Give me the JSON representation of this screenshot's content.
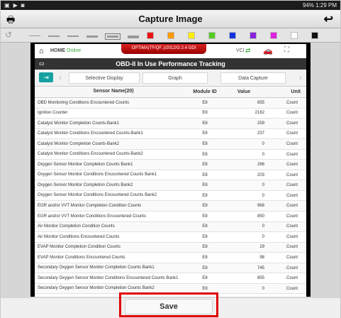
{
  "status_bar": {
    "right": "94% 1:29 PM"
  },
  "title_bar": {
    "title": "Capture Image"
  },
  "toolbar": {
    "swatches": [
      "#ee1111",
      "#ff9900",
      "#ffee00",
      "#55cc22",
      "#1133dd",
      "#8822dd",
      "#dd22dd",
      "#ffffff",
      "#111111"
    ]
  },
  "app_header": {
    "home": "HOME",
    "online": "Online",
    "vehicle": "OPTIMA(TF/QF..)/2012/G 2.4 GDI",
    "vci": "VCI"
  },
  "page_title": "OBD-II In Use Performance Tracking",
  "tabs": [
    "Selective Display",
    "Graph",
    "Data Capture"
  ],
  "table": {
    "columns": [
      "Sensor Name(20)",
      "Module ID",
      "Value",
      "Unit"
    ],
    "rows": [
      [
        "OBD Monitoring Conditions Encountered Counts",
        "E8",
        "855",
        "Count"
      ],
      [
        "Ignition Counter",
        "E8",
        "2162",
        "Count"
      ],
      [
        "Catalyst Monitor Completion Counts-Bank1",
        "E8",
        "259",
        "Count"
      ],
      [
        "Catalyst Monitor Conditions Encountered Counts-Bank1",
        "E8",
        "237",
        "Count"
      ],
      [
        "Catalyst Monitor Completion Counts-Bank2",
        "E8",
        "0",
        "Count"
      ],
      [
        "Catalyst Monitor Conditions Encountered Counts-Bank2",
        "E8",
        "0",
        "Count"
      ],
      [
        "Oxygen Sensor Monitor Completion Counts Bank1",
        "E8",
        "266",
        "Count"
      ],
      [
        "Oxygen Sensor Monitor Conditions Encountered Counts Bank1",
        "E8",
        "203",
        "Count"
      ],
      [
        "Oxygen Sensor Monitor Completion Counts Bank2",
        "E8",
        "0",
        "Count"
      ],
      [
        "Oxygen Sensor Monitor Conditions Encountered Counts Bank2",
        "E8",
        "0",
        "Count"
      ],
      [
        "EGR and/or VVT Monitor Completion Condition Counts",
        "E8",
        "968",
        "Count"
      ],
      [
        "EGR and/or VVT Monitor Conditions Encountered Counts",
        "E8",
        "850",
        "Count"
      ],
      [
        "Air Monitor Completion Condition Counts",
        "E8",
        "0",
        "Count"
      ],
      [
        "Air Monitor Conditions Encountered Counts",
        "E8",
        "0",
        "Count"
      ],
      [
        "EVAP Monitor Completion Condition Counts",
        "E8",
        "29",
        "Count"
      ],
      [
        "EVAP Monitor Conditions Encountered Counts",
        "E8",
        "98",
        "Count"
      ],
      [
        "Secondary Oxygen Sensor Monitor Completion Counts Bank1",
        "E8",
        "745",
        "Count"
      ],
      [
        "Secondary Oxygen Sensor Monitor Conditions Encountered Counts Bank1",
        "E8",
        "855",
        "Count"
      ],
      [
        "Secondary Oxygen Sensor Monitor Completion Counts Bank2",
        "E8",
        "0",
        "Count"
      ]
    ]
  },
  "save_label": "Save"
}
